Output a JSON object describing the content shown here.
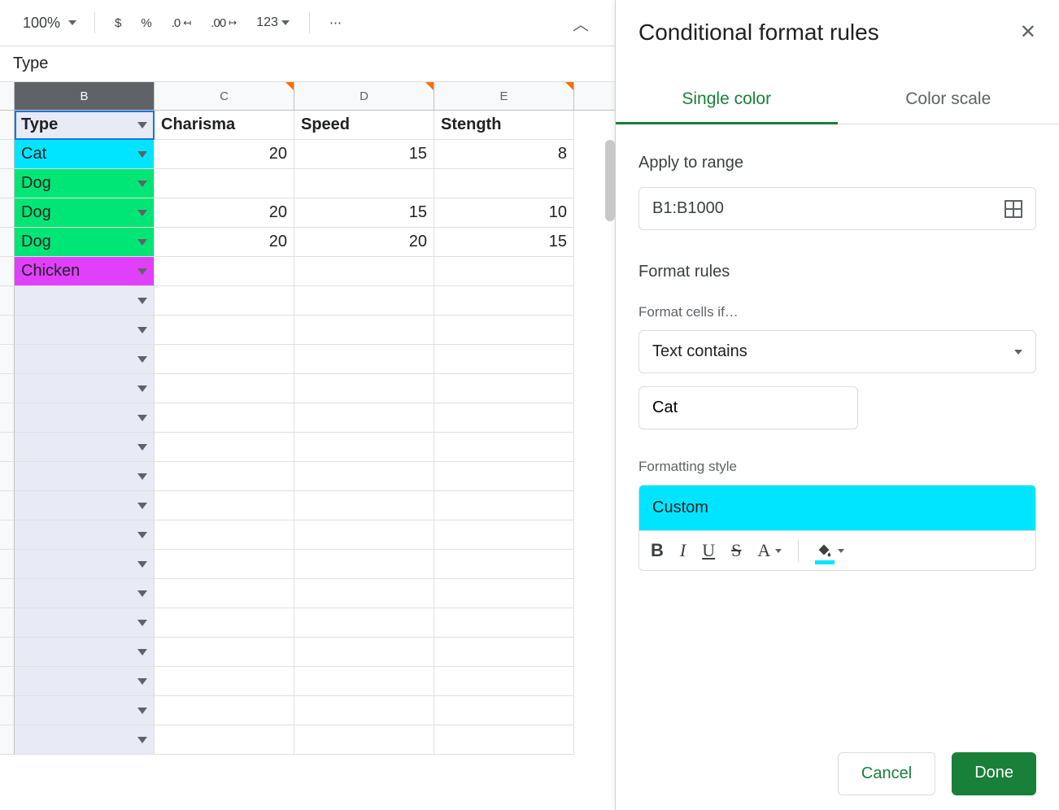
{
  "toolbar": {
    "zoom": "100%",
    "currency": "$",
    "percent": "%",
    "dec_decrease": ".0",
    "dec_increase": ".00",
    "numfmt": "123",
    "more": "⋯"
  },
  "formula_bar": "Type",
  "columns": [
    "B",
    "C",
    "D",
    "E"
  ],
  "headers": {
    "b": "Type",
    "c": "Charisma",
    "d": "Speed",
    "e": "Stength"
  },
  "rows": [
    {
      "b": "Cat",
      "c": "20",
      "d": "15",
      "e": "8",
      "cls": "cat"
    },
    {
      "b": "Dog",
      "c": "",
      "d": "",
      "e": "",
      "cls": "dog"
    },
    {
      "b": "Dog",
      "c": "20",
      "d": "15",
      "e": "10",
      "cls": "dog"
    },
    {
      "b": "Dog",
      "c": "20",
      "d": "20",
      "e": "15",
      "cls": "dog"
    },
    {
      "b": "Chicken",
      "c": "",
      "d": "",
      "e": "",
      "cls": "chicken"
    }
  ],
  "panel": {
    "title": "Conditional format rules",
    "tab_single": "Single color",
    "tab_scale": "Color scale",
    "apply_label": "Apply to range",
    "range": "B1:B1000",
    "rules_label": "Format rules",
    "cells_if": "Format cells if…",
    "condition": "Text contains",
    "value": "Cat",
    "style_label": "Formatting style",
    "style_name": "Custom",
    "cancel": "Cancel",
    "done": "Done",
    "accent": "#00e5ff"
  }
}
